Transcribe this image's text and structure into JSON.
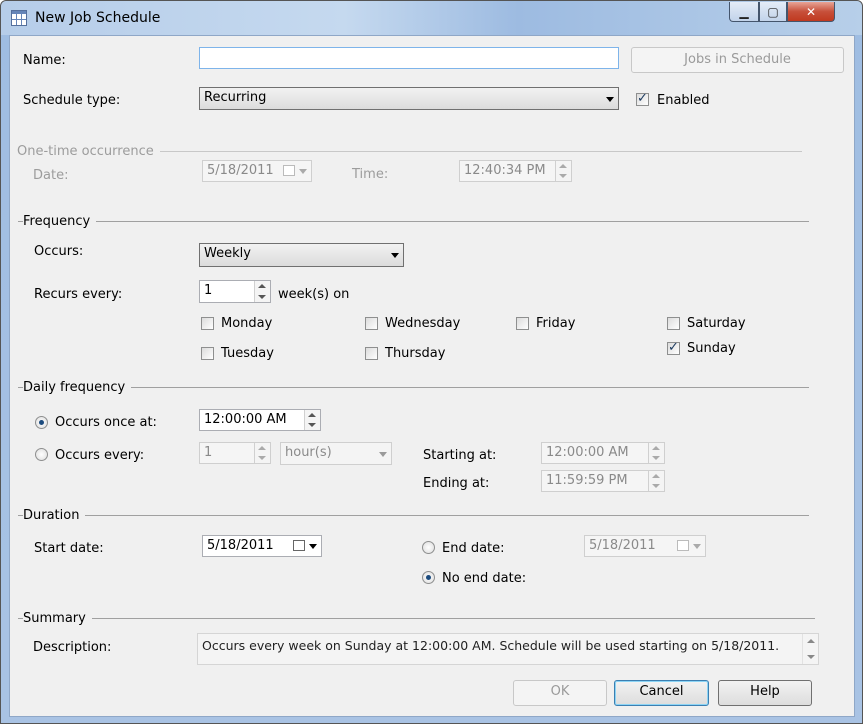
{
  "window": {
    "title": "New Job Schedule",
    "min_glyph": "▁",
    "max_glyph": "▢",
    "close_glyph": "✕"
  },
  "name": {
    "label": "Name:",
    "value": ""
  },
  "jobs_in_schedule": {
    "label": "Jobs in Schedule"
  },
  "schedule_type": {
    "label": "Schedule type:",
    "value": "Recurring"
  },
  "enabled": {
    "label": "Enabled",
    "checked": true
  },
  "one_time": {
    "section": "One-time occurrence",
    "date_label": "Date:",
    "date_value": "5/18/2011",
    "time_label": "Time:",
    "time_value": "12:40:34 PM"
  },
  "frequency": {
    "section": "Frequency",
    "occurs_label": "Occurs:",
    "occurs_value": "Weekly",
    "recurs_label": "Recurs every:",
    "recurs_value": "1",
    "recurs_unit": "week(s) on",
    "days": {
      "monday": {
        "label": "Monday",
        "checked": false
      },
      "tuesday": {
        "label": "Tuesday",
        "checked": false
      },
      "wednesday": {
        "label": "Wednesday",
        "checked": false
      },
      "thursday": {
        "label": "Thursday",
        "checked": false
      },
      "friday": {
        "label": "Friday",
        "checked": false
      },
      "saturday": {
        "label": "Saturday",
        "checked": false
      },
      "sunday": {
        "label": "Sunday",
        "checked": true
      }
    }
  },
  "daily": {
    "section": "Daily frequency",
    "once_label": "Occurs once at:",
    "once_value": "12:00:00 AM",
    "once_selected": true,
    "every_label": "Occurs every:",
    "every_value": "1",
    "every_unit": "hour(s)",
    "starting_label": "Starting at:",
    "starting_value": "12:00:00 AM",
    "ending_label": "Ending at:",
    "ending_value": "11:59:59 PM"
  },
  "duration": {
    "section": "Duration",
    "start_label": "Start date:",
    "start_value": "5/18/2011",
    "end_label": "End date:",
    "end_value": "5/18/2011",
    "no_end_label": "No end date:",
    "no_end_selected": true
  },
  "summary": {
    "section": "Summary",
    "desc_label": "Description:",
    "desc_value": "Occurs every week on Sunday at 12:00:00 AM. Schedule will be used starting on 5/18/2011."
  },
  "buttons": {
    "ok": "OK",
    "cancel": "Cancel",
    "help": "Help"
  }
}
